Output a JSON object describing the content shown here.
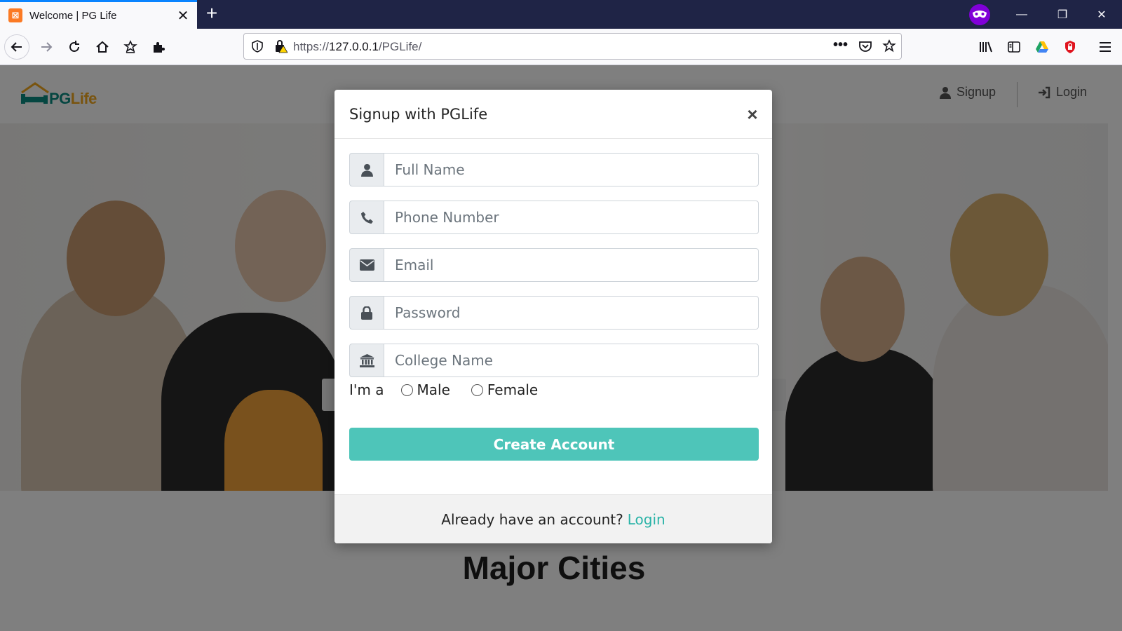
{
  "browser": {
    "tab_title": "Welcome | PG Life",
    "favicon": "xampp-icon",
    "url_prefix": "https://",
    "url_host": "127.0.0.1",
    "url_path": "/PGLife/",
    "page_actions": "•••"
  },
  "site": {
    "logo_pg": "PG",
    "logo_life": "Life",
    "nav": {
      "signup_label": "Signup",
      "login_label": "Login"
    },
    "section_title": "Major Cities"
  },
  "modal": {
    "title": "Signup with PGLife",
    "close_glyph": "×",
    "fields": {
      "full_name_placeholder": "Full Name",
      "phone_placeholder": "Phone Number",
      "email_placeholder": "Email",
      "password_placeholder": "Password",
      "college_placeholder": "College Name"
    },
    "gender": {
      "prompt": "I'm a",
      "male_label": "Male",
      "female_label": "Female"
    },
    "submit_label": "Create Account",
    "footer_text": "Already have an account?",
    "footer_link": "Login"
  },
  "colors": {
    "accent": "#4ec5b9",
    "link": "#29b3a7",
    "chrome_dark": "#1f2446",
    "private_badge": "#8000d7"
  }
}
